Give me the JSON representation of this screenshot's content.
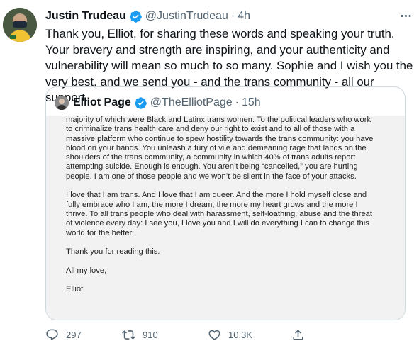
{
  "author": {
    "name": "Justin Trudeau",
    "handle": "@JustinTrudeau",
    "separator": "·",
    "time": "4h"
  },
  "tweet_text": "Thank you, Elliot, for sharing these words and speaking your truth. Your bravery and strength are inspiring, and your authenticity and vulnerability will mean so much to so many. Sophie and I wish you the very best, and we send you - and the trans community - all our support.",
  "quoted": {
    "name": "Elliot Page",
    "handle": "@TheElliotPage",
    "separator": "·",
    "time": "15h",
    "image_text": {
      "para1": [
        "majority of which were Black and Latinx trans women. To the political leaders who work",
        "to criminalize trans health care and deny our right to exist and to all of those with a",
        "massive platform who continue to spew hostility towards the trans community: you have",
        "blood on your hands. You unleash a fury of vile and demeaning rage that lands on the",
        "shoulders of the trans community, a community in which 40% of trans adults report",
        "attempting suicide. Enough is enough. You aren’t being “cancelled,” you are hurting",
        "people. I am one of those people and we won’t be silent in the face of your attacks."
      ],
      "para2": [
        "I love that I am trans. And I love that I am queer. And the more I hold myself close and",
        "fully embrace who I am, the more I dream, the more my heart grows and the more I",
        "thrive. To all trans people who deal with harassment, self-loathing, abuse and the threat",
        "of violence every day: I see you, I love you and I will do everything I can to change this",
        "world for the better."
      ],
      "thanks": "Thank you for reading this.",
      "closing": "All my love,",
      "signature": "Elliot"
    }
  },
  "actions": {
    "replies": "297",
    "retweets": "910",
    "likes": "10.3K"
  },
  "colors": {
    "verified_badge": "#1d9bf0",
    "secondary_text": "#536471",
    "border": "#cfd9de"
  },
  "icons": [
    "verified-badge-icon",
    "more-icon",
    "reply-icon",
    "retweet-icon",
    "like-icon",
    "share-icon"
  ]
}
